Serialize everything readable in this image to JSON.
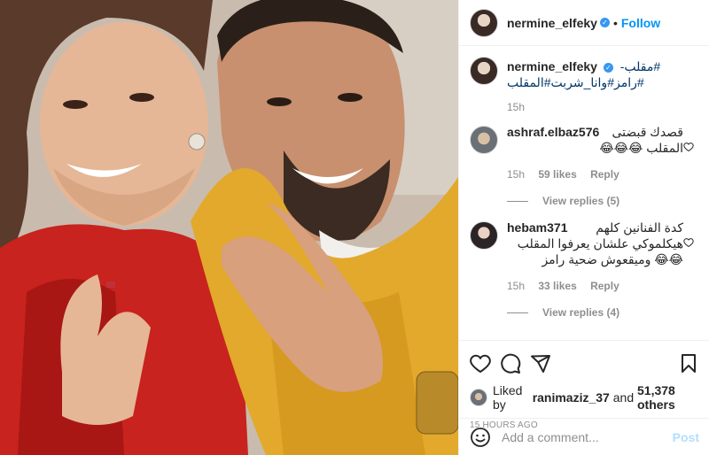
{
  "post": {
    "username": "nermine_elfeky",
    "follow_label": "Follow",
    "separator": "•"
  },
  "caption": {
    "username": "nermine_elfeky",
    "text_prefix": "-مقلب",
    "hashtags_line1": "#",
    "hashtags_line2": "#رامز#وانا_شربت#المقلب",
    "time": "15h"
  },
  "comments": [
    {
      "username": "ashraf.elbaz576",
      "text_line1": "قصدك قبضتى",
      "text_line2": "المقلب 😂😂😂",
      "time": "15h",
      "likes": "59 likes",
      "reply": "Reply",
      "view_replies": "View replies (5)"
    },
    {
      "username": "hebam371",
      "text_line1": "كدة الفنانين كلهم",
      "text_line2": "هيكلموكي علشان يعرفوا المقلب",
      "text_line3": "😂😂 وميقعوش ضحية رامز",
      "time": "15h",
      "likes": "33 likes",
      "reply": "Reply",
      "view_replies": "View replies (4)"
    }
  ],
  "likes": {
    "prefix": "Liked by",
    "user": "ranimaziz_37",
    "middle": "and",
    "count": "51,378 others"
  },
  "timestamp": "15 HOURS AGO",
  "add_comment": {
    "placeholder": "Add a comment...",
    "post_label": "Post"
  },
  "icons": {
    "like": "heart-icon",
    "comment": "comment-icon",
    "share": "share-icon",
    "save": "bookmark-icon",
    "emoji": "emoji-icon",
    "verified": "verified-badge-icon"
  },
  "colors": {
    "accent": "#0095f6",
    "link": "#00376b",
    "muted": "#8e8e8e",
    "border": "#efefef",
    "post_disabled": "#b2dffc"
  }
}
